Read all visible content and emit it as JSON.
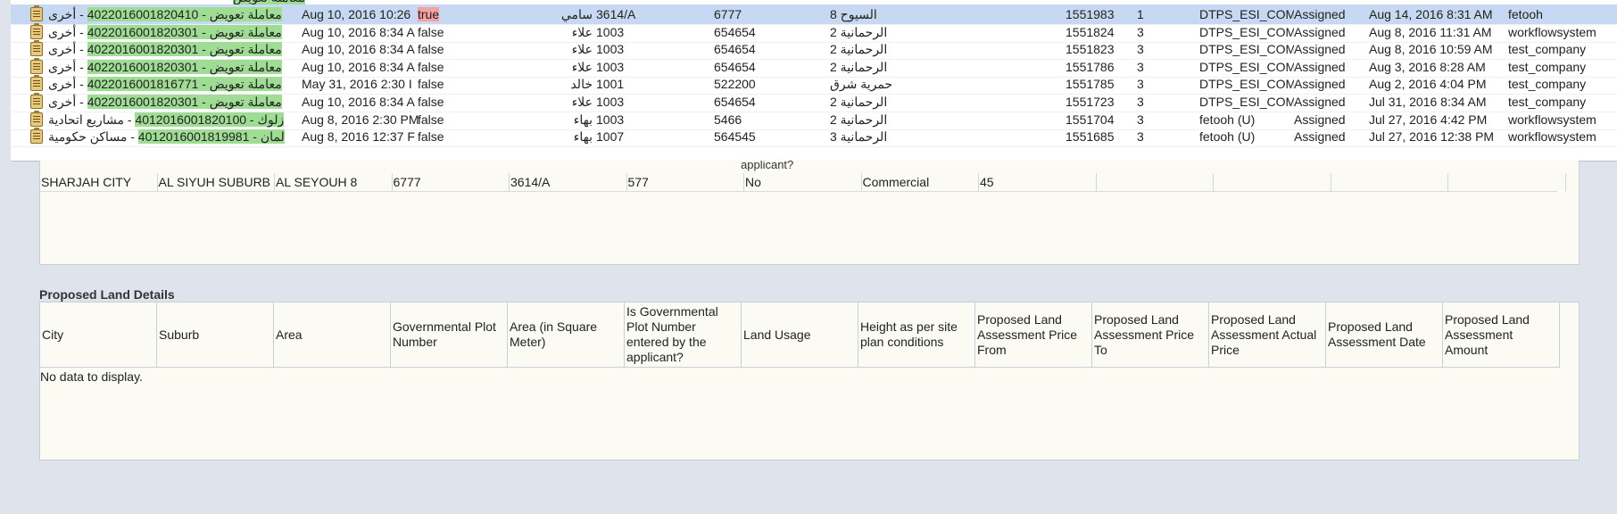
{
  "task_list": {
    "partial_top_row": {
      "desc_arabic": "معاملة تعويض",
      "by": ""
    },
    "rows": [
      {
        "desc_arabic": "معاملة تعويض",
        "desc_number": "4022016001820410",
        "category": "أخرى",
        "date": "Aug 10, 2016 10:26",
        "flag": "true",
        "user": "سامي",
        "plot": "3614/A",
        "plot_no": "6777",
        "area": "السيوح 8",
        "number": "1551983",
        "priority": "1",
        "queue": "DTPS_ESI_COM",
        "state": "Assigned",
        "assigned": "Aug 14, 2016 8:31 AM",
        "by": "fetooh",
        "selected": true
      },
      {
        "desc_arabic": "معاملة تعويض",
        "desc_number": "4022016001820301",
        "category": "أخرى",
        "date": "Aug 10, 2016 8:34 A",
        "flag": "false",
        "user": "علاء",
        "plot": "1003",
        "plot_no": "654654",
        "area": "الرحمانية 2",
        "number": "1551824",
        "priority": "3",
        "queue": "DTPS_ESI_COM",
        "state": "Assigned",
        "assigned": "Aug 8, 2016 11:31 AM",
        "by": "workflowsystem"
      },
      {
        "desc_arabic": "معاملة تعويض",
        "desc_number": "4022016001820301",
        "category": "أخرى",
        "date": "Aug 10, 2016 8:34 A",
        "flag": "false",
        "user": "علاء",
        "plot": "1003",
        "plot_no": "654654",
        "area": "الرحمانية 2",
        "number": "1551823",
        "priority": "3",
        "queue": "DTPS_ESI_COM",
        "state": "Assigned",
        "assigned": "Aug 8, 2016 10:59 AM",
        "by": "test_company"
      },
      {
        "desc_arabic": "معاملة تعويض",
        "desc_number": "4022016001820301",
        "category": "أخرى",
        "date": "Aug 10, 2016 8:34 A",
        "flag": "false",
        "user": "علاء",
        "plot": "1003",
        "plot_no": "654654",
        "area": "الرحمانية 2",
        "number": "1551786",
        "priority": "3",
        "queue": "DTPS_ESI_COM",
        "state": "Assigned",
        "assigned": "Aug 3, 2016 8:28 AM",
        "by": "test_company"
      },
      {
        "desc_arabic": "معاملة تعويض",
        "desc_number": "4022016001816771",
        "category": "أخرى",
        "date": "May 31, 2016 2:30 I",
        "flag": "false",
        "user": "خالد",
        "plot": "1001",
        "plot_no": "522200",
        "area": "حمرية شرق",
        "number": "1551785",
        "priority": "3",
        "queue": "DTPS_ESI_COM",
        "state": "Assigned",
        "assigned": "Aug 2, 2016 4:04 PM",
        "by": "test_company"
      },
      {
        "desc_arabic": "معاملة تعويض",
        "desc_number": "4022016001820301",
        "category": "أخرى",
        "date": "Aug 10, 2016 8:34 A",
        "flag": "false",
        "user": "علاء",
        "plot": "1003",
        "plot_no": "654654",
        "area": "الرحمانية 2",
        "number": "1551723",
        "priority": "3",
        "queue": "DTPS_ESI_COM",
        "state": "Assigned",
        "assigned": "Jul 31, 2016 8:34 AM",
        "by": "test_company"
      },
      {
        "desc_arabic": "زلوك",
        "desc_number": "4012016001820100",
        "category": "مشاريع اتحادية",
        "date": "Aug 8, 2016 2:30 PM",
        "flag": "false",
        "user": "بهاء",
        "plot": "1003",
        "plot_no": "5466",
        "area": "الرحمانية 2",
        "number": "1551704",
        "priority": "3",
        "queue": "fetooh (U)",
        "state": "Assigned",
        "assigned": "Jul 27, 2016 4:42 PM",
        "by": "workflowsystem"
      },
      {
        "desc_arabic": "لمان",
        "desc_number": "4012016001819981",
        "category": "مساكن حكومية",
        "date": "Aug 8, 2016 12:37 F",
        "flag": "false",
        "user": "بهاء",
        "plot": "1007",
        "plot_no": "564545",
        "area": "الرحمانية 3",
        "number": "1551685",
        "priority": "3",
        "queue": "fetooh (U)",
        "state": "Assigned",
        "assigned": "Jul 27, 2016 12:38 PM",
        "by": "workflowsystem"
      }
    ]
  },
  "current_land": {
    "header_tail": "applicant?",
    "row": [
      "SHARJAH CITY",
      "AL SIYUH SUBURB",
      "AL SEYOUH 8",
      "6777",
      "3614/A",
      "577",
      "No",
      "Commercial",
      "45",
      "",
      "",
      "",
      "",
      ""
    ]
  },
  "proposed_land": {
    "title": "Proposed Land Details",
    "columns": [
      "City",
      "Suburb",
      "Area",
      "Governmental Plot Number",
      "Area (in Square Meter)",
      "Is Governmental Plot Number entered by the applicant?",
      "Land Usage",
      "Height as per site plan conditions",
      "Proposed Land Assessment Price From",
      "Proposed Land Assessment Price To",
      "Proposed Land Assessment Actual Price",
      "Proposed Land Assessment Date",
      "Proposed Land Assessment Amount"
    ],
    "empty_text": "No data to display."
  },
  "colors": {
    "selected_row": "#c7d9f2",
    "highlight_green": "#9fdc94",
    "highlight_red": "#f3a1a1",
    "panel_bg": "#fbfbf4",
    "page_bg": "#dfe4ec"
  }
}
